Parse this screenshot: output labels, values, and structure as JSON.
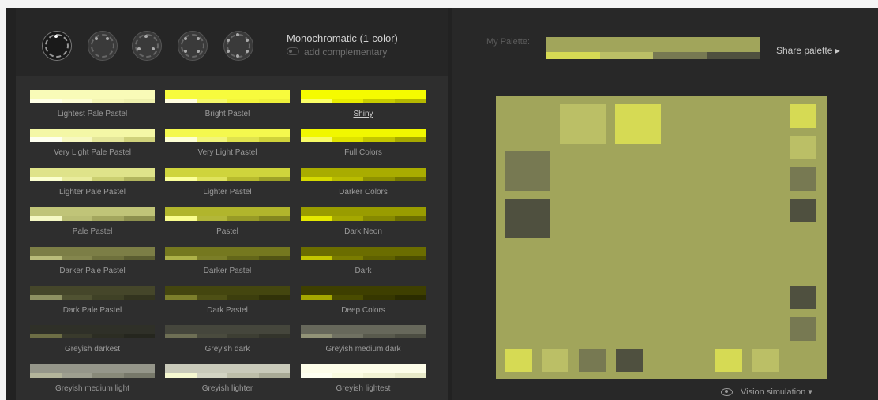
{
  "header": {
    "scheme_title": "Monochromatic (1-color)",
    "complementary_label": "add complementary"
  },
  "mode_icons": [
    {
      "name": "mono-mode-icon",
      "active": true
    },
    {
      "name": "adjacent-mode-icon",
      "active": false
    },
    {
      "name": "triad-mode-icon",
      "active": false
    },
    {
      "name": "tetrad-mode-icon",
      "active": false
    },
    {
      "name": "freestyle-mode-icon",
      "active": false
    }
  ],
  "presets": [
    {
      "label": "Lightest Pale Pastel",
      "main": "#f9fbb8",
      "strip": [
        "#ffffe7",
        "#fdfdd2",
        "#f4f5b4",
        "#eef0ad"
      ],
      "selected": false
    },
    {
      "label": "Bright Pastel",
      "main": "#f7fb3d",
      "strip": [
        "#fffde0",
        "#f5f86a",
        "#f3f53c",
        "#eef03a"
      ],
      "selected": false
    },
    {
      "label": "Shiny",
      "main": "#f5fb00",
      "strip": [
        "#fbff66",
        "#e8ec00",
        "#c8cc00",
        "#b5b800"
      ],
      "selected": true
    },
    {
      "label": "Very Light Pale Pastel",
      "main": "#f4f7a6",
      "strip": [
        "#fefff0",
        "#f7f8c0",
        "#e4e699",
        "#cfd17b"
      ],
      "selected": false
    },
    {
      "label": "Very Light Pastel",
      "main": "#f4f84e",
      "strip": [
        "#fdffd5",
        "#f2f57a",
        "#e0e34e",
        "#cfd23a"
      ],
      "selected": false
    },
    {
      "label": "Full Colors",
      "main": "#f1f700",
      "strip": [
        "#f8fb66",
        "#dfe300",
        "#c3c600",
        "#a6a800"
      ],
      "selected": false
    },
    {
      "label": "Lighter Pale Pastel",
      "main": "#dfe38a",
      "strip": [
        "#fbffd0",
        "#e9ec9d",
        "#cbcf71",
        "#b2b55e"
      ],
      "selected": false
    },
    {
      "label": "Lighter Pastel",
      "main": "#cfd43c",
      "strip": [
        "#fbff9a",
        "#dfe35c",
        "#b8bb2e",
        "#9ea127"
      ],
      "selected": false
    },
    {
      "label": "Darker Colors",
      "main": "#a9ac00",
      "strip": [
        "#d6da00",
        "#b9bc00",
        "#8f9200",
        "#767800"
      ],
      "selected": false
    },
    {
      "label": "Pale Pastel",
      "main": "#c0c478",
      "strip": [
        "#f5f8c4",
        "#b9bd73",
        "#a3a65e",
        "#8d904e"
      ],
      "selected": false
    },
    {
      "label": "Pastel",
      "main": "#b1b52c",
      "strip": [
        "#fafd8e",
        "#b3b738",
        "#989b26",
        "#83861f"
      ],
      "selected": false
    },
    {
      "label": "Dark Neon",
      "main": "#999c00",
      "strip": [
        "#e4e800",
        "#a5a800",
        "#868900",
        "#6c6e00"
      ],
      "selected": false
    },
    {
      "label": "Darker Pale Pastel",
      "main": "#7c7e46",
      "strip": [
        "#b9bc7a",
        "#84864d",
        "#6e703c",
        "#5b5d31"
      ],
      "selected": false
    },
    {
      "label": "Darker Pastel",
      "main": "#75781f",
      "strip": [
        "#adb148",
        "#7b7e27",
        "#636619",
        "#525414"
      ],
      "selected": false
    },
    {
      "label": "Dark",
      "main": "#6b6d00",
      "strip": [
        "#c3c600",
        "#7a7c00",
        "#5f6100",
        "#4c4e00"
      ],
      "selected": false
    },
    {
      "label": "Dark Pale Pastel",
      "main": "#45462a",
      "strip": [
        "#8e9162",
        "#505232",
        "#3f4126",
        "#33341f"
      ],
      "selected": false
    },
    {
      "label": "Dark Pastel",
      "main": "#44460f",
      "strip": [
        "#7c7f2b",
        "#4e5015",
        "#3c3e0d",
        "#313209"
      ],
      "selected": false
    },
    {
      "label": "Deep Colors",
      "main": "#3e3f00",
      "strip": [
        "#a4a700",
        "#4a4c00",
        "#363700",
        "#2b2c00"
      ],
      "selected": false
    },
    {
      "label": "Greyish darkest",
      "main": "#2f3028",
      "strip": [
        "#6d6e45",
        "#393a2c",
        "#2c2d23",
        "#25261e"
      ],
      "selected": false
    },
    {
      "label": "Greyish dark",
      "main": "#45463c",
      "strip": [
        "#6e6f55",
        "#4a4b3e",
        "#3d3e33",
        "#33342b"
      ],
      "selected": false
    },
    {
      "label": "Greyish medium dark",
      "main": "#67685b",
      "strip": [
        "#929377",
        "#707162",
        "#595a4d",
        "#4c4d42"
      ],
      "selected": false
    },
    {
      "label": "Greyish medium light",
      "main": "#95968a",
      "strip": [
        "#b3b49b",
        "#9e9f90",
        "#888979",
        "#77786a"
      ],
      "selected": false
    },
    {
      "label": "Greyish lighter",
      "main": "#c9caba",
      "strip": [
        "#f6f8d0",
        "#d3d4c3",
        "#bdbea9",
        "#a9aa96"
      ],
      "selected": false
    },
    {
      "label": "Greyish lightest",
      "main": "#fdfde9",
      "strip": [
        "#fefff1",
        "#fafbe0",
        "#f1f2d3",
        "#e8e9c8"
      ],
      "selected": false
    }
  ],
  "my_palette": {
    "label": "My Palette:",
    "main": "#a1a55b",
    "strip": [
      "#d6da54",
      "#bbbf66",
      "#777952",
      "#4f503f"
    ]
  },
  "share_label": "Share palette ▸",
  "preview": {
    "background": "#a1a55b",
    "squares": [
      {
        "color": "#bbbf66"
      },
      {
        "color": "#d6da54"
      },
      {
        "color": "#d6da54"
      },
      {
        "color": "#bbbf66"
      },
      {
        "color": "#777952"
      },
      {
        "color": "#4f503f"
      },
      {
        "color": "#777952"
      },
      {
        "color": "#4f503f"
      },
      {
        "color": "#4f503f"
      },
      {
        "color": "#777952"
      },
      {
        "color": "#d6da54"
      },
      {
        "color": "#bbbf66"
      },
      {
        "color": "#777952"
      },
      {
        "color": "#4f503f"
      },
      {
        "color": "#d6da54"
      },
      {
        "color": "#bbbf66"
      }
    ]
  },
  "vision_label": "Vision simulation ▾"
}
